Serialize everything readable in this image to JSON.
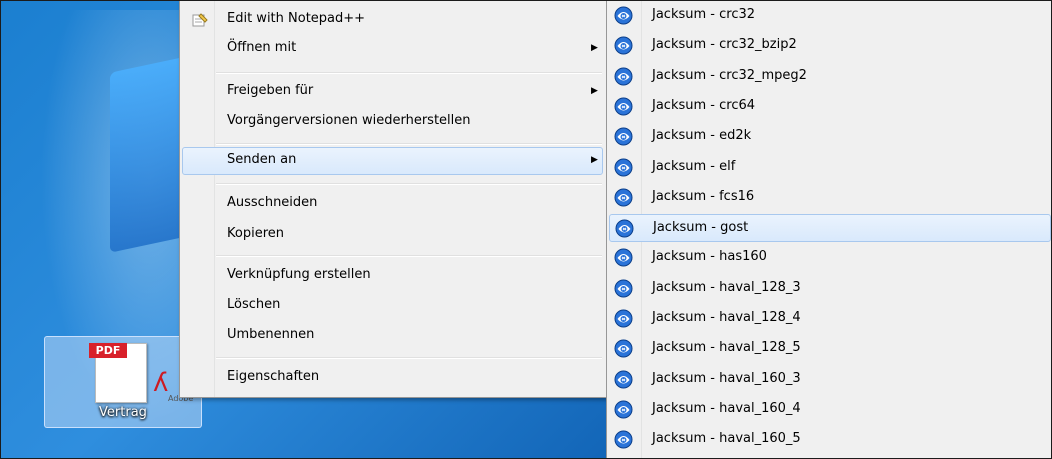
{
  "desktop": {
    "icon_label": "Vertrag",
    "icon_badge": "PDF",
    "icon_brand": "Adobe",
    "icon_name": "pdf-file-icon"
  },
  "context_menu": {
    "items": [
      {
        "label": "Edit with Notepad++",
        "icon": "notepad-plus-plus-icon",
        "submenu": false
      },
      {
        "label": "Öffnen mit",
        "submenu": true
      },
      {
        "label": "Freigeben für",
        "submenu": true
      },
      {
        "label": "Vorgängerversionen wiederherstellen",
        "submenu": false
      },
      {
        "label": "Senden an",
        "submenu": true,
        "highlighted": true
      },
      {
        "label": "Ausschneiden",
        "submenu": false
      },
      {
        "label": "Kopieren",
        "submenu": false
      },
      {
        "label": "Verknüpfung erstellen",
        "submenu": false
      },
      {
        "label": "Löschen",
        "submenu": false
      },
      {
        "label": "Umbenennen",
        "submenu": false
      },
      {
        "label": "Eigenschaften",
        "submenu": false
      }
    ],
    "arrow_glyph": "▶"
  },
  "send_to_menu": {
    "icon": "jacksum-icon",
    "items": [
      "Jacksum - crc32",
      "Jacksum - crc32_bzip2",
      "Jacksum - crc32_mpeg2",
      "Jacksum - crc64",
      "Jacksum - ed2k",
      "Jacksum - elf",
      "Jacksum - fcs16",
      "Jacksum - gost",
      "Jacksum - has160",
      "Jacksum - haval_128_3",
      "Jacksum - haval_128_4",
      "Jacksum - haval_128_5",
      "Jacksum - haval_160_3",
      "Jacksum - haval_160_4",
      "Jacksum - haval_160_5"
    ],
    "highlighted_index": 7
  },
  "colors": {
    "menu_bg": "#f0f0f0",
    "highlight_border": "#a8c8ee",
    "desktop_blue": "#1b7fd0"
  }
}
